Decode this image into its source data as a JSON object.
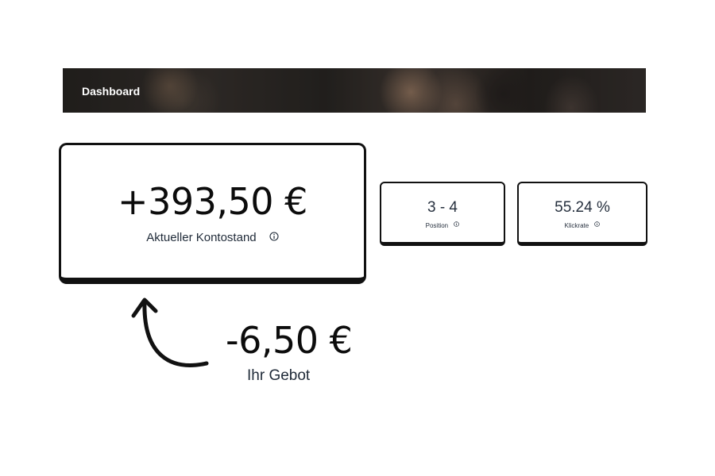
{
  "header": {
    "title": "Dashboard"
  },
  "balance": {
    "value": "+393,50 €",
    "label": "Aktueller Kontostand"
  },
  "stats": [
    {
      "value": "3 - 4",
      "label": "Position"
    },
    {
      "value": "55.24 %",
      "label": "Klickrate"
    }
  ],
  "bid": {
    "value": "-6,50 €",
    "label": "Ihr Gebot"
  },
  "icons": {
    "info": "info-icon",
    "arrow": "curved-arrow-icon"
  },
  "colors": {
    "text": "#141821",
    "border": "#111111",
    "banner_text": "#ffffff"
  }
}
